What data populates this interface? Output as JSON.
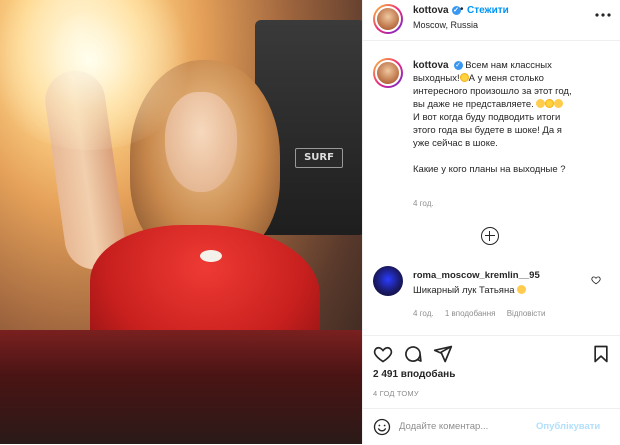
{
  "post": {
    "photo_sign_text": "SURF"
  },
  "header": {
    "username": "kottova",
    "dot": "•",
    "follow_label": "Стежити",
    "location": "Moscow, Russia",
    "more_icon": "more-horizontal-icon"
  },
  "caption": {
    "username": "kottova",
    "lines": [
      "Всем нам классных",
      "выходных!",
      "А у меня столько",
      "интересного произошло за этот год,",
      "вы даже не представляете.",
      "И вот когда буду подводить итоги",
      "этого года вы будете в шоке! Да я",
      "уже сейчас в шоке.",
      "",
      "Какие у кого планы на выходные ?"
    ],
    "time_ago": "4 год."
  },
  "load_more_icon": "plus-circle-icon",
  "comment": {
    "username": "roma_moscow_kremlin__95",
    "text": "Шикарный лук Татьяна",
    "time_ago": "4 год.",
    "likes": "1 вподобання",
    "reply": "Відповісти"
  },
  "actions": {
    "like_icon": "heart-icon",
    "comment_icon": "comment-icon",
    "share_icon": "paper-plane-icon",
    "save_icon": "bookmark-icon"
  },
  "likes_text": "2 491 вподобань",
  "date_text": "4 ГОД ТОМУ",
  "add_comment": {
    "placeholder": "Додайте коментар...",
    "post_label": "Опублікувати"
  },
  "colors": {
    "accent": "#0095f6",
    "post_disabled": "#b2dffc",
    "secondary_text": "#8e8e8e",
    "divider": "#efefef"
  }
}
